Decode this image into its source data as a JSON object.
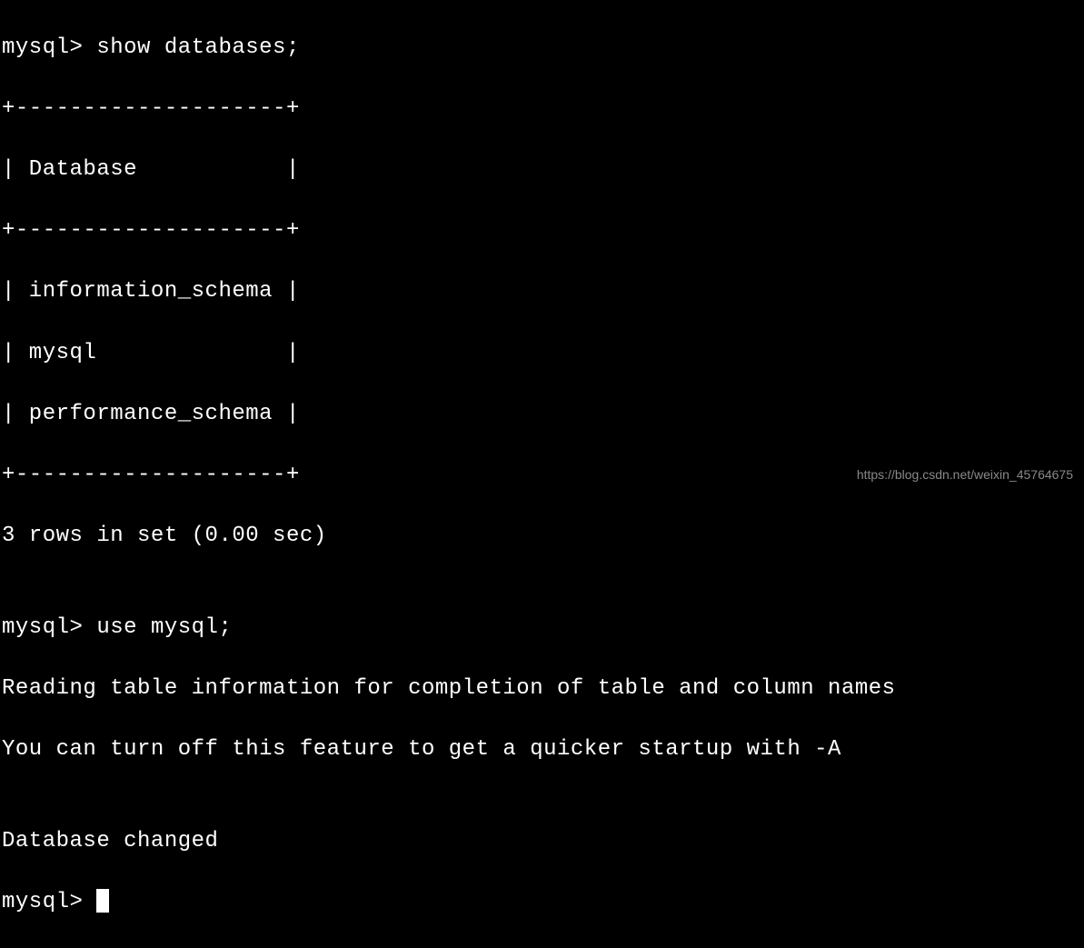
{
  "terminal": {
    "prompt": "mysql> ",
    "command1": "show databases;",
    "table_border_top": "+--------------------+",
    "table_header_row": "| Database           |",
    "table_border_mid": "+--------------------+",
    "table_rows": [
      "| information_schema |",
      "| mysql              |",
      "| performance_schema |"
    ],
    "table_border_bottom": "+--------------------+",
    "result_summary": "3 rows in set (0.00 sec)",
    "blank": "",
    "command2": "use mysql;",
    "info_line1": "Reading table information for completion of table and column names",
    "info_line2": "You can turn off this feature to get a quicker startup with -A",
    "status": "Database changed"
  },
  "watermark": "https://blog.csdn.net/weixin_45764675"
}
